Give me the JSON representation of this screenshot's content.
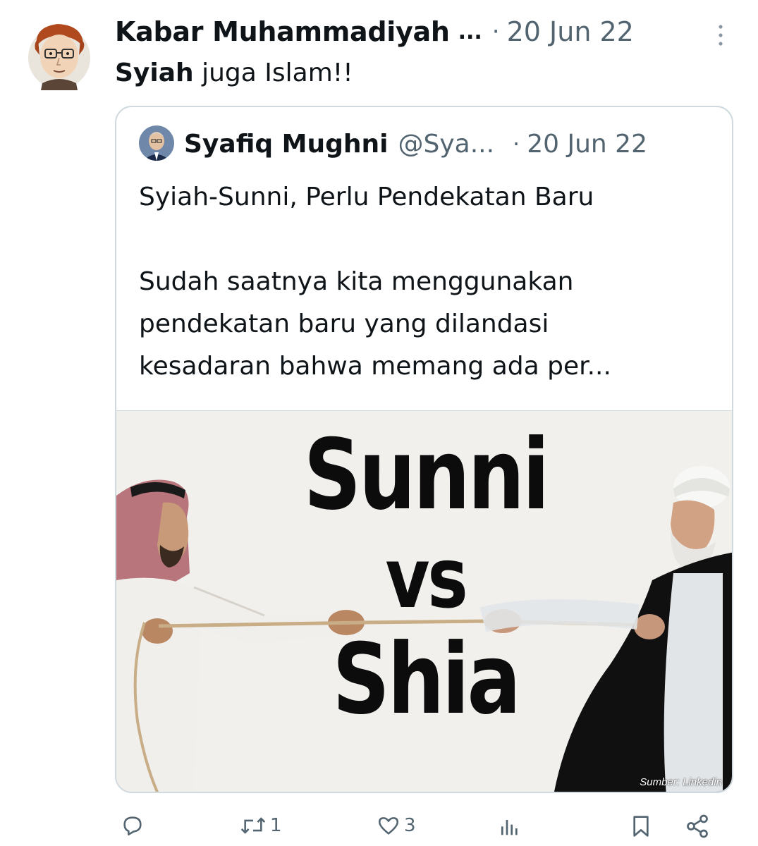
{
  "tweet": {
    "author_name": "Kabar Muhammadiyah",
    "truncation": "...",
    "separator": "·",
    "date": "20 Jun 22",
    "text_bold": "Syiah",
    "text_rest": " juga Islam!!"
  },
  "quote": {
    "name": "Syafiq Mughni",
    "handle": "@Sya...",
    "separator": "·",
    "date": "20 Jun 22",
    "title_line": "Syiah-Sunni, Perlu Pendekatan Baru",
    "body_lines": [
      "Sudah saatnya kita menggunakan",
      "pendekatan baru yang dilandasi",
      "kesadaran bahwa memang ada per..."
    ],
    "image": {
      "line1": "Sunni",
      "line2": "vs",
      "line3": "Shia",
      "credit": "Sumber: Linkedin"
    }
  },
  "actions": {
    "reply_count": "",
    "retweet_count": "1",
    "like_count": "3",
    "views_count": ""
  },
  "icons": {
    "more": "more-vertical-icon",
    "reply": "reply-icon",
    "retweet": "retweet-icon",
    "like": "heart-icon",
    "views": "views-icon",
    "bookmark": "bookmark-icon",
    "share": "share-icon"
  },
  "colors": {
    "text": "#0f1419",
    "secondary": "#536471",
    "border": "#cfd9de"
  }
}
